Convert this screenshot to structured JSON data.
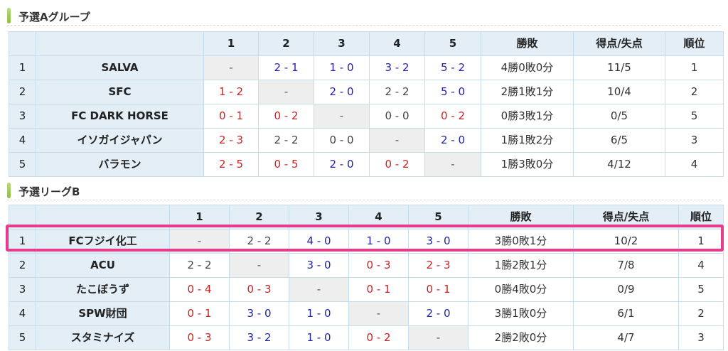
{
  "group_a": {
    "title": "予選Aグループ",
    "headers": [
      "",
      "",
      "1",
      "2",
      "3",
      "4",
      "5",
      "勝敗",
      "得点/失点",
      "順位"
    ],
    "rows": [
      {
        "num": "1",
        "team": "SALVA",
        "results": [
          {
            "t": "-",
            "s": "self"
          },
          {
            "t": "2 - 1",
            "s": "win"
          },
          {
            "t": "1 - 0",
            "s": "win"
          },
          {
            "t": "3 - 2",
            "s": "win"
          },
          {
            "t": "5 - 2",
            "s": "win"
          }
        ],
        "record": "4勝0敗0分",
        "score": "11/5",
        "rank": "1"
      },
      {
        "num": "2",
        "team": "SFC",
        "results": [
          {
            "t": "1 - 2",
            "s": "lose"
          },
          {
            "t": "-",
            "s": "self"
          },
          {
            "t": "2 - 0",
            "s": "win"
          },
          {
            "t": "2 - 2",
            "s": "draw"
          },
          {
            "t": "5 - 0",
            "s": "win"
          }
        ],
        "record": "2勝1敗1分",
        "score": "10/4",
        "rank": "2"
      },
      {
        "num": "3",
        "team": "FC DARK HORSE",
        "results": [
          {
            "t": "0 - 1",
            "s": "lose"
          },
          {
            "t": "0 - 2",
            "s": "lose"
          },
          {
            "t": "-",
            "s": "self"
          },
          {
            "t": "0 - 0",
            "s": "draw"
          },
          {
            "t": "0 - 2",
            "s": "lose"
          }
        ],
        "record": "0勝3敗1分",
        "score": "0/5",
        "rank": "5"
      },
      {
        "num": "4",
        "team": "イソガイジャパン",
        "results": [
          {
            "t": "2 - 3",
            "s": "lose"
          },
          {
            "t": "2 - 2",
            "s": "draw"
          },
          {
            "t": "0 - 0",
            "s": "draw"
          },
          {
            "t": "-",
            "s": "self"
          },
          {
            "t": "2 - 0",
            "s": "win"
          }
        ],
        "record": "1勝1敗2分",
        "score": "6/5",
        "rank": "3"
      },
      {
        "num": "5",
        "team": "バラモン",
        "results": [
          {
            "t": "2 - 5",
            "s": "lose"
          },
          {
            "t": "0 - 5",
            "s": "lose"
          },
          {
            "t": "2 - 0",
            "s": "win"
          },
          {
            "t": "0 - 2",
            "s": "lose"
          },
          {
            "t": "-",
            "s": "self"
          }
        ],
        "record": "1勝3敗0分",
        "score": "4/12",
        "rank": "4"
      }
    ]
  },
  "group_b": {
    "title": "予選リーグB",
    "headers": [
      "",
      "",
      "1",
      "2",
      "3",
      "4",
      "5",
      "勝敗",
      "得点/失点",
      "順位"
    ],
    "rows": [
      {
        "num": "1",
        "team": "FCフジイ化工",
        "results": [
          {
            "t": "-",
            "s": "self"
          },
          {
            "t": "2 - 2",
            "s": "draw"
          },
          {
            "t": "4 - 0",
            "s": "win"
          },
          {
            "t": "1 - 0",
            "s": "win"
          },
          {
            "t": "3 - 0",
            "s": "win"
          }
        ],
        "record": "3勝0敗1分",
        "score": "10/2",
        "rank": "1"
      },
      {
        "num": "2",
        "team": "ACU",
        "results": [
          {
            "t": "2 - 2",
            "s": "draw"
          },
          {
            "t": "-",
            "s": "self"
          },
          {
            "t": "3 - 0",
            "s": "win"
          },
          {
            "t": "0 - 3",
            "s": "lose"
          },
          {
            "t": "2 - 3",
            "s": "lose"
          }
        ],
        "record": "1勝2敗1分",
        "score": "7/8",
        "rank": "4"
      },
      {
        "num": "3",
        "team": "たこぼうず",
        "results": [
          {
            "t": "0 - 4",
            "s": "lose"
          },
          {
            "t": "0 - 3",
            "s": "lose"
          },
          {
            "t": "-",
            "s": "self"
          },
          {
            "t": "0 - 1",
            "s": "lose"
          },
          {
            "t": "0 - 1",
            "s": "lose"
          }
        ],
        "record": "0勝4敗0分",
        "score": "0/9",
        "rank": "5"
      },
      {
        "num": "4",
        "team": "SPW財団",
        "results": [
          {
            "t": "0 - 1",
            "s": "lose"
          },
          {
            "t": "3 - 0",
            "s": "win"
          },
          {
            "t": "1 - 0",
            "s": "win"
          },
          {
            "t": "-",
            "s": "self"
          },
          {
            "t": "2 - 0",
            "s": "win"
          }
        ],
        "record": "3勝1敗0分",
        "score": "6/1",
        "rank": "2"
      },
      {
        "num": "5",
        "team": "スタミナイズ",
        "results": [
          {
            "t": "0 - 3",
            "s": "lose"
          },
          {
            "t": "3 - 2",
            "s": "win"
          },
          {
            "t": "1 - 0",
            "s": "win"
          },
          {
            "t": "0 - 2",
            "s": "lose"
          },
          {
            "t": "-",
            "s": "self"
          }
        ],
        "record": "2勝2敗0分",
        "score": "4/7",
        "rank": "3"
      }
    ],
    "highlighted_row": 1
  },
  "colors": {
    "win": "#2222aa",
    "lose": "#cc2222",
    "header_bg": "#e3eef7",
    "highlight": "#e53c8c",
    "accent_bar": "#8fbf3f"
  }
}
